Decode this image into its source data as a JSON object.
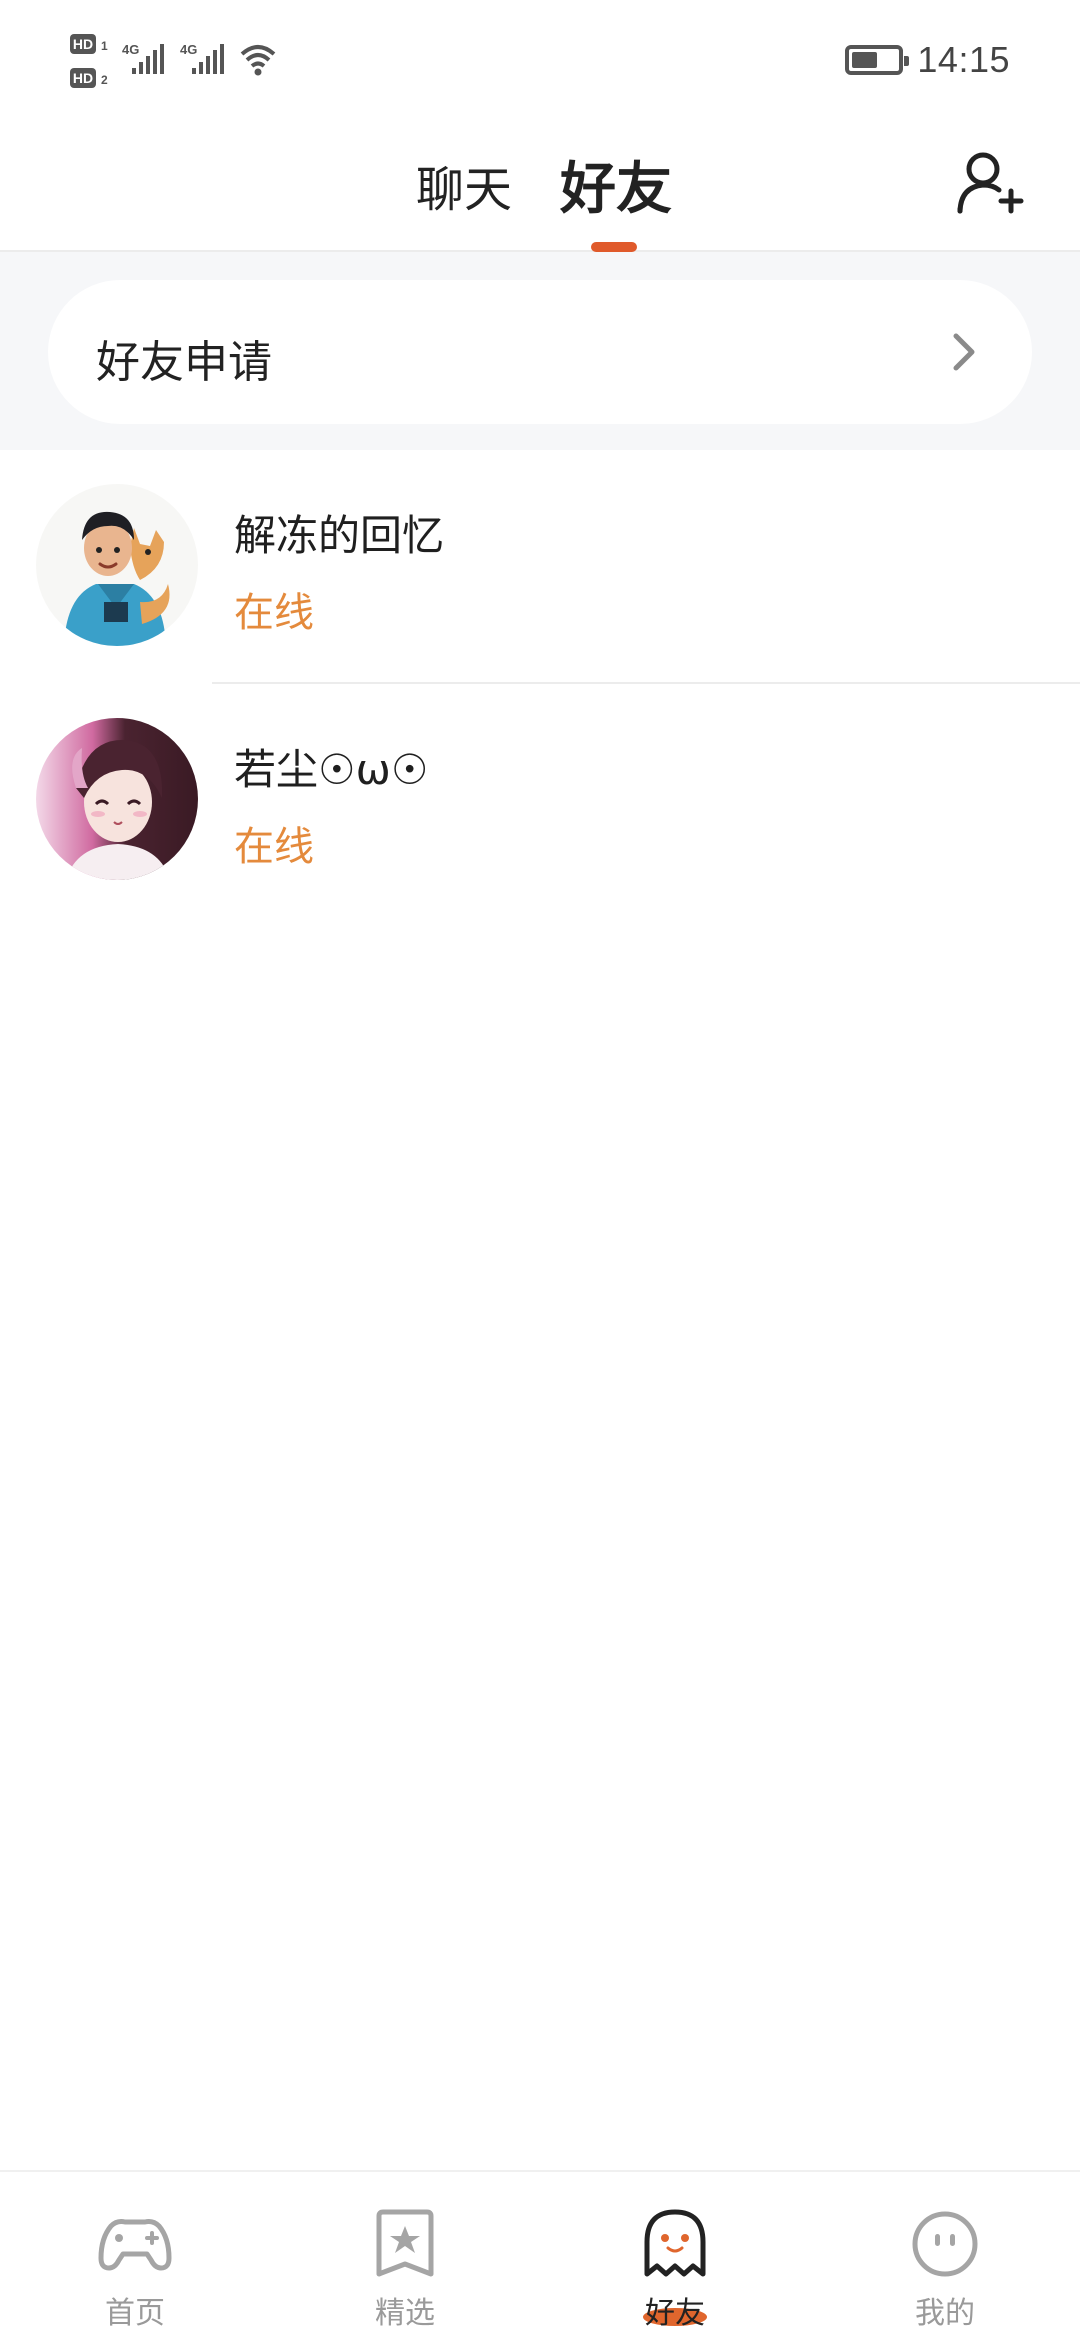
{
  "status_bar": {
    "sim1_label": "HD",
    "sim1_index": "1",
    "sim2_label": "HD",
    "sim2_index": "2",
    "network_type_1": "4G",
    "network_type_2": "4G",
    "battery_level_pct": 55,
    "time": "14:15"
  },
  "header": {
    "tabs": [
      {
        "label": "聊天",
        "active": false
      },
      {
        "label": "好友",
        "active": true
      }
    ],
    "add_friend_icon": "add-user-icon",
    "accent_color": "#e05a2b"
  },
  "friend_request": {
    "label": "好友申请",
    "chevron_icon": "chevron-right-icon"
  },
  "friends": [
    {
      "name": "解冻的回忆",
      "status": "在线"
    },
    {
      "name": "若尘☉ω☉",
      "status": "在线"
    }
  ],
  "status_color": "#e48a3c",
  "bottom_nav": {
    "items": [
      {
        "label": "首页",
        "icon": "gamepad-icon",
        "active": false
      },
      {
        "label": "精选",
        "icon": "star-bookmark-icon",
        "active": false
      },
      {
        "label": "好友",
        "icon": "ghost-icon",
        "active": true
      },
      {
        "label": "我的",
        "icon": "face-icon",
        "active": false
      }
    ]
  }
}
